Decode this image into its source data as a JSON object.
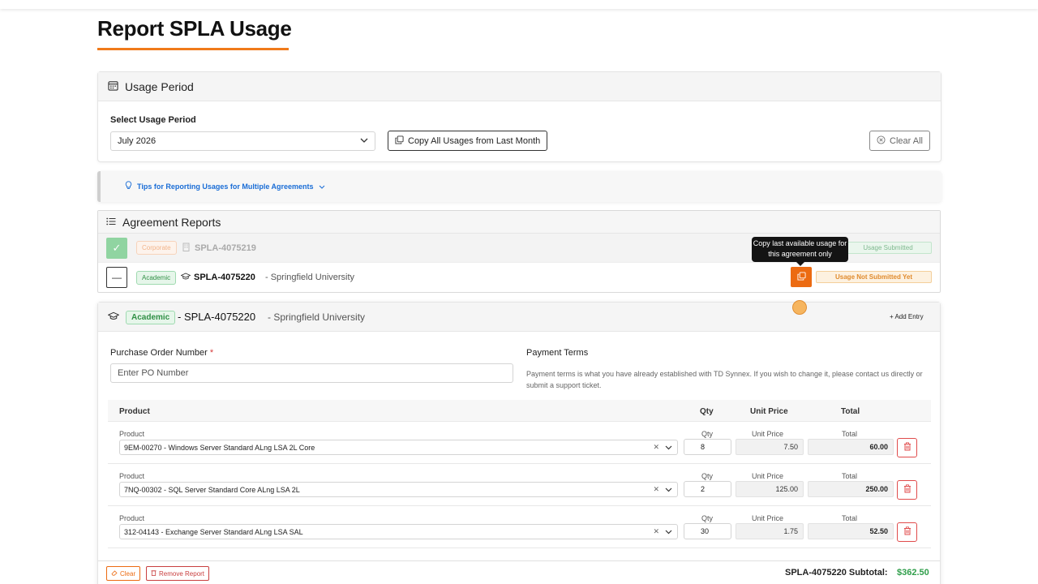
{
  "page": {
    "title": "Report SPLA Usage"
  },
  "usage_period": {
    "heading": "Usage Period",
    "select_label": "Select Usage Period",
    "selected": "July 2026",
    "copy_all_label": "Copy All Usages from Last Month",
    "clear_all_label": "Clear All"
  },
  "tips": {
    "label": "Tips for Reporting Usages for Multiple Agreements"
  },
  "agreement_reports": {
    "heading": "Agreement Reports",
    "rows": [
      {
        "type": "Corporate",
        "agreement": "SPLA-4075219",
        "customer": "",
        "status": "Usage Submitted"
      },
      {
        "type": "Academic",
        "agreement": "SPLA-4075220",
        "customer": "- Springfield University",
        "status": "Usage Not Submitted Yet"
      }
    ],
    "tooltip": "Copy last available usage for this agreement only"
  },
  "detail": {
    "type": "Academic",
    "agreement": "- SPLA-4075220",
    "customer": "- Springfield University",
    "add_entry": "+ Add Entry",
    "po_label": "Purchase Order Number",
    "po_required": "*",
    "po_placeholder": "Enter PO Number",
    "payment_terms_label": "Payment Terms",
    "payment_terms_text": "Payment terms is what you have already established with TD Synnex. If you wish to change it, please contact us directly or submit a support ticket.",
    "columns": {
      "product": "Product",
      "qty": "Qty",
      "unit_price": "Unit Price",
      "total": "Total"
    },
    "items": [
      {
        "product": "9EM-00270 - Windows Server Standard ALng LSA 2L Core",
        "qty": "8",
        "unit_price": "7.50",
        "total": "60.00"
      },
      {
        "product": "7NQ-00302 - SQL Server Standard Core ALng LSA 2L",
        "qty": "2",
        "unit_price": "125.00",
        "total": "250.00"
      },
      {
        "product": "312-04143 - Exchange Server Standard ALng LSA SAL",
        "qty": "30",
        "unit_price": "1.75",
        "total": "52.50"
      }
    ],
    "clear_label": "Clear",
    "remove_label": "Remove Report",
    "subtotal_label": "SPLA-4075220 Subtotal:",
    "subtotal_value": "$362.50"
  }
}
